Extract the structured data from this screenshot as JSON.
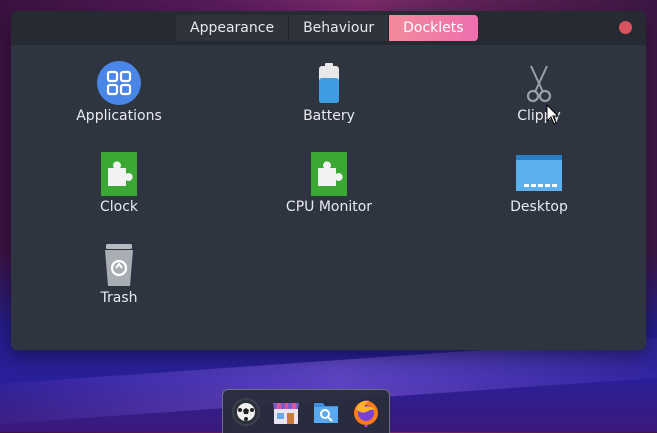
{
  "tabs": [
    {
      "label": "Appearance"
    },
    {
      "label": "Behaviour"
    },
    {
      "label": "Docklets",
      "active": true
    }
  ],
  "docklets": [
    {
      "label": "Applications",
      "icon": "applications-icon"
    },
    {
      "label": "Battery",
      "icon": "battery-icon"
    },
    {
      "label": "Clippy",
      "icon": "scissors-icon"
    },
    {
      "label": "Clock",
      "icon": "puzzle-piece-icon"
    },
    {
      "label": "CPU Monitor",
      "icon": "puzzle-piece-icon"
    },
    {
      "label": "Desktop",
      "icon": "desktop-icon"
    },
    {
      "label": "Trash",
      "icon": "trash-icon"
    }
  ],
  "dock": {
    "items": [
      "soccer-ball-icon",
      "store-icon",
      "file-manager-icon",
      "firefox-icon"
    ]
  },
  "colors": {
    "window_bg": "#2e3440",
    "titlebar_bg": "#252a33",
    "active_tab": "#f06fb0",
    "close_button": "#d9535e",
    "puzzle_green": "#3aa832",
    "battery_blue": "#3d9de3"
  }
}
